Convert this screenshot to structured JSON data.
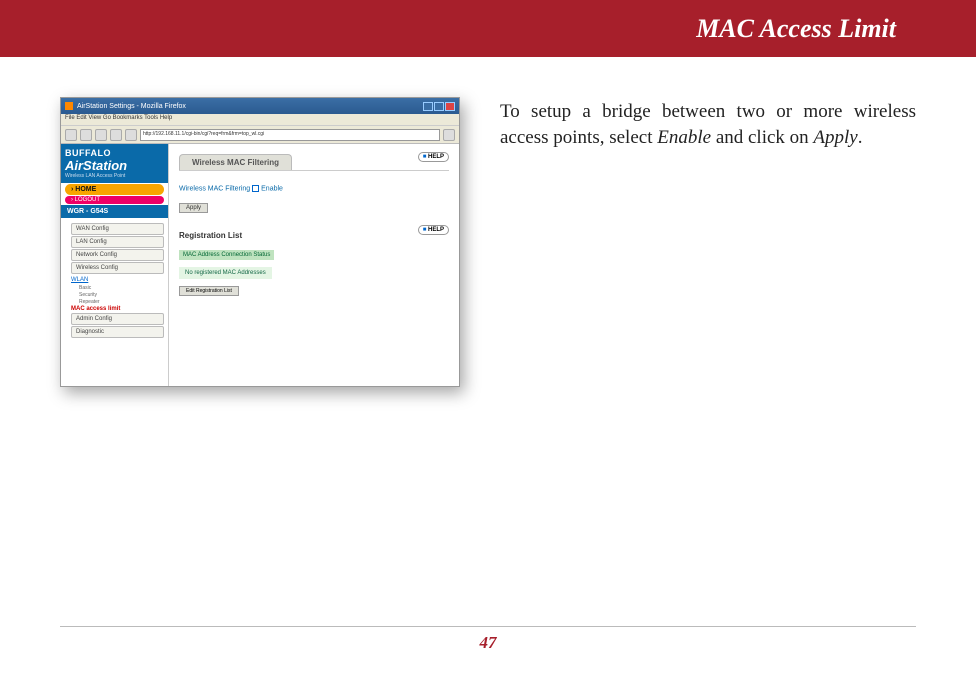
{
  "header": {
    "title": "MAC Access Limit"
  },
  "instruction": {
    "part1": "To setup a bridge between two or more wireless access points, select ",
    "em1": "Enable",
    "part2": " and click on ",
    "em2": "Apply",
    "part3": "."
  },
  "page_number": "47",
  "screenshot": {
    "window_title": "AirStation Settings - Mozilla Firefox",
    "menubar": "File  Edit  View  Go  Bookmarks  Tools  Help",
    "url": "http://192.168.11.1/cgi-bin/cgi?req=frm&frm=top_wl.cgi",
    "logo_brand": "BUFFALO",
    "logo_product": "AirStation",
    "logo_sub": "Wireless LAN Access Point",
    "nav": {
      "home": "›  HOME",
      "logout": "›  LOGOUT",
      "model": "WGR - G54S"
    },
    "sidebar": {
      "buttons": [
        "WAN Config",
        "LAN Config",
        "Network Config",
        "Wireless Config"
      ],
      "section": "WLAN",
      "items": [
        "Basic",
        "Security",
        "Repeater"
      ],
      "active": "MAC access limit",
      "buttons2": [
        "Admin Config",
        "Diagnostic"
      ]
    },
    "main": {
      "tab": "Wireless MAC Filtering",
      "help": "HELP",
      "filter_label": "Wireless MAC Filtering",
      "enable": "Enable",
      "apply": "Apply",
      "reg_title": "Registration List",
      "reg_head": "MAC Address Connection Status",
      "reg_empty": "No registered MAC Addresses",
      "reg_btn": "Edit Registration List"
    }
  }
}
